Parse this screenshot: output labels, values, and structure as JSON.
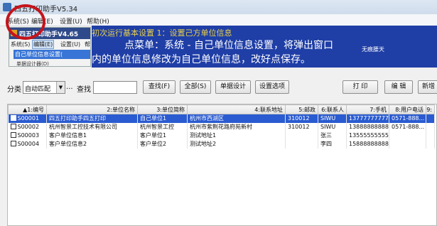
{
  "window": {
    "title": "四五打印助手V5.34"
  },
  "menu": [
    "系统(S)",
    "编辑(E)",
    "设置(U)",
    "帮助(H)"
  ],
  "inner": {
    "title": "四五打印助手V4.65",
    "menu": [
      "系统(S)",
      "编辑(E)",
      "设置(U)",
      "帮"
    ],
    "highlight": "自己单位信息设置(",
    "next_item": "单据设计器(D)"
  },
  "banner": {
    "line1": "初次运行基本设置 1：设置己方单位信息",
    "line2": "点菜单：系统 - 自己单位信息设置，将弹出窗口",
    "line3": "内的单位信息修改为自己单位信息，改好点保存。",
    "side_text": "无痕腰天"
  },
  "toolbar": {
    "category_label": "分类",
    "category_value": "自动匹配",
    "dots": "...",
    "search_label": "查找",
    "search_value": "",
    "buttons": [
      "查找(F)",
      "全部(S)",
      "单据设计",
      "设置选项",
      "打 印",
      "编 辑",
      "新增"
    ]
  },
  "table": {
    "headers": [
      "▲1:编号",
      "2:单位名称",
      "3:单位简称",
      "4:联系地址",
      "5:邮政",
      "6:联系人",
      "7:手机",
      "8:用户电话",
      "9:"
    ],
    "rows": [
      [
        "S00001",
        "四五打印助手四五打印",
        "自己单位1",
        "杭州市西湖区",
        "310012",
        "SIWU",
        "13777777777",
        "0571-888...",
        ""
      ],
      [
        "S00002",
        "杭州智景工控技术有限公司",
        "杭州智景工控",
        "杭州市紫荆花路府苑新村",
        "310012",
        "SIWU",
        "13888888888",
        "0571-888...",
        ""
      ],
      [
        "S00003",
        "客户单位信息1",
        "客户单位1",
        "测试地址1",
        "",
        "张三",
        "13555555555",
        "",
        ""
      ],
      [
        "S00004",
        "客户单位信息2",
        "客户单位2",
        "测试地址2",
        "",
        "李四",
        "15888888888",
        "",
        ""
      ]
    ]
  }
}
